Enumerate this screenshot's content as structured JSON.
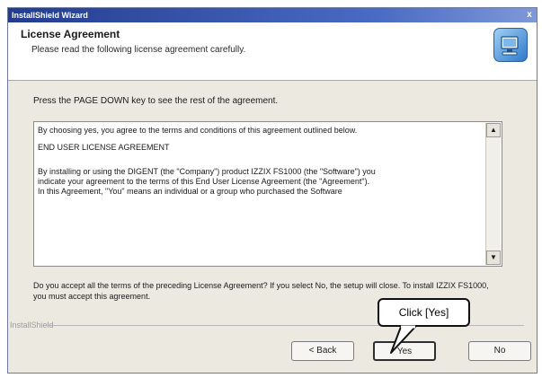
{
  "window": {
    "title": "InstallShield Wizard",
    "close_label": "x"
  },
  "header": {
    "title": "License Agreement",
    "subtitle": "Please read the following license agreement carefully.",
    "icon": "installer-computer-icon"
  },
  "instruction": "Press the PAGE DOWN key to see the rest of the agreement.",
  "license": {
    "lines": [
      "By choosing yes, you agree to the terms and conditions of this agreement outlined below.",
      "END USER LICENSE AGREEMENT",
      "By installing or using the DIGENT (the \"Company\") product IZZIX FS1000 (the \"Software\") you",
      "indicate your agreement to the terms of this End User License Agreement (the \"Agreement\").",
      "In this Agreement, \"You\" means an individual or a group who purchased the Software"
    ]
  },
  "accept_text": "Do you accept all the terms of the preceding License Agreement? If you select No, the setup will close. To install IZZIX FS1000, you must accept this agreement.",
  "footer": {
    "installshield_label": "InstallShield"
  },
  "buttons": {
    "back": "< Back",
    "yes": "Yes",
    "no": "No"
  },
  "callout": {
    "text": "Click [Yes]"
  }
}
